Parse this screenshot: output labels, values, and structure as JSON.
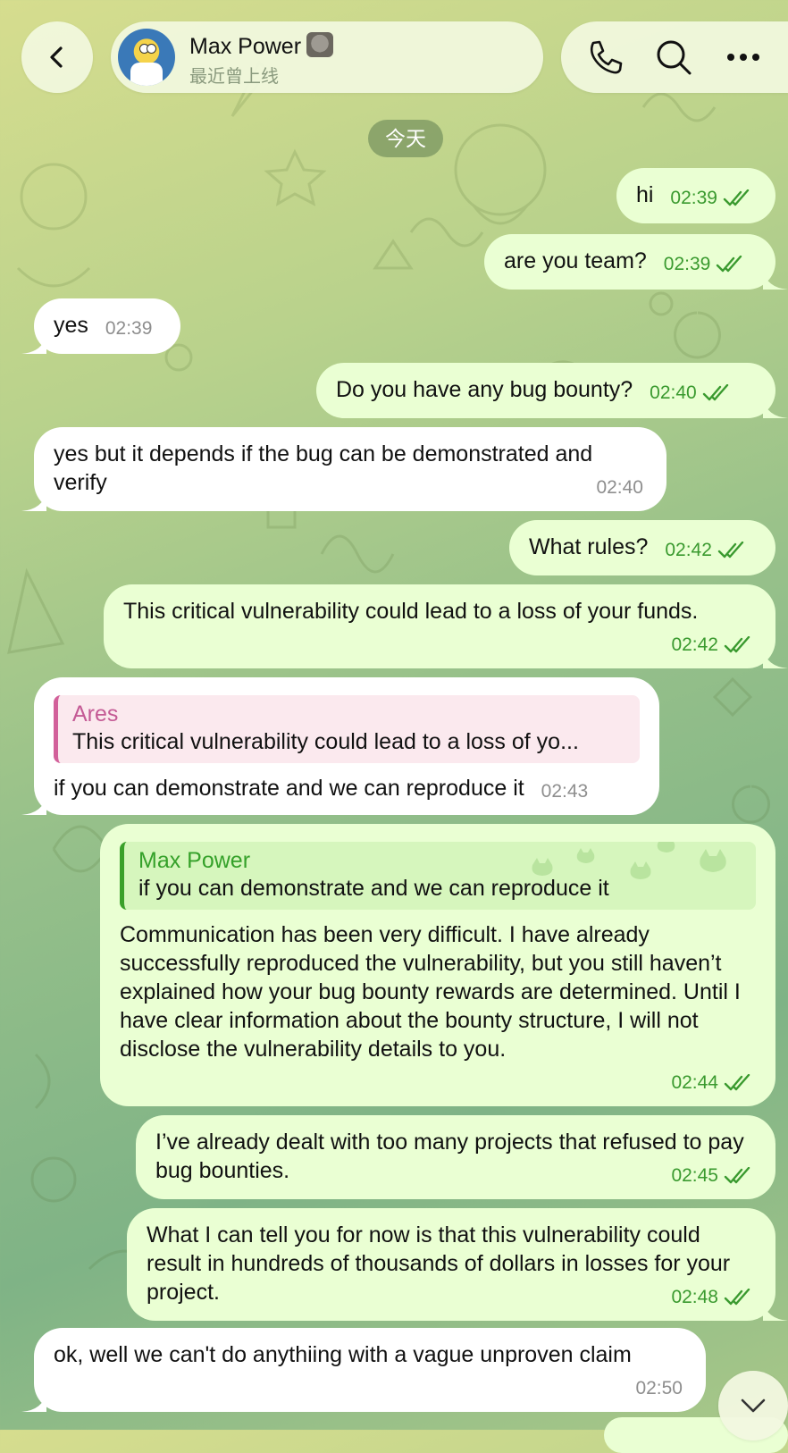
{
  "header": {
    "contact_name": "Max Power",
    "contact_status": "最近曾上线",
    "back_icon": "chevron-left-icon",
    "call_icon": "phone-icon",
    "search_icon": "search-icon",
    "more_icon": "more-horizontal-icon"
  },
  "date_separator": "今天",
  "colors": {
    "outgoing_bubble": "#eaffd3",
    "incoming_bubble": "#ffffff",
    "outgoing_time": "#3a9a2f",
    "reply_ares": "#c45a95",
    "reply_max": "#35a12a"
  },
  "messages": [
    {
      "direction": "out",
      "text": "hi",
      "time": "02:39",
      "status": "read"
    },
    {
      "direction": "out",
      "text": "are you team?",
      "time": "02:39",
      "status": "read"
    },
    {
      "direction": "in",
      "text": "yes",
      "time": "02:39"
    },
    {
      "direction": "out",
      "text": "Do you have any bug bounty?",
      "time": "02:40",
      "status": "read"
    },
    {
      "direction": "in",
      "text": "yes but it depends if the bug can be demonstrated and verify",
      "time": "02:40"
    },
    {
      "direction": "out",
      "text": "What rules?",
      "time": "02:42",
      "status": "read"
    },
    {
      "direction": "out",
      "text": "This critical vulnerability could lead to a loss of your funds.",
      "time": "02:42",
      "status": "read"
    },
    {
      "direction": "in",
      "reply_name": "Ares",
      "reply_text": "This critical vulnerability could lead to a loss of yo...",
      "text": "if you can demonstrate and we can reproduce it",
      "time": "02:43"
    },
    {
      "direction": "out",
      "reply_name": "Max Power",
      "reply_text": "if you can demonstrate and we can reproduce it",
      "text": "Communication has been very difficult. I have already successfully reproduced the vulnerability, but you still haven’t explained how your bug bounty rewards are determined. Until I have clear information about the bounty structure, I will not disclose the vulnerability details to you.",
      "time": "02:44",
      "status": "read"
    },
    {
      "direction": "out",
      "text": "I’ve already dealt with too many projects that refused to pay bug bounties.",
      "time": "02:45",
      "status": "read"
    },
    {
      "direction": "out",
      "text": "What I can tell you for now is that this vulnerability could result in hundreds of thousands of dollars in losses for your project.",
      "time": "02:48",
      "status": "read"
    },
    {
      "direction": "in",
      "text": "ok, well we can't do anythiing with a vague unproven claim",
      "time": "02:50"
    }
  ],
  "scroll_down_icon": "chevron-down-icon"
}
